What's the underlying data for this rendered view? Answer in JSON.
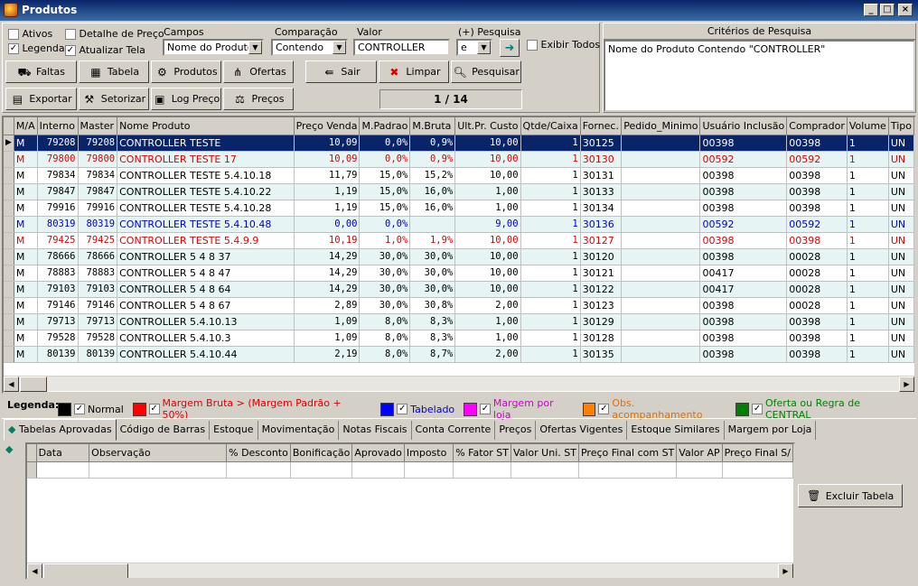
{
  "window": {
    "title": "Produtos",
    "min": "_",
    "max": "□",
    "close": "×"
  },
  "filters": {
    "ativos": "Ativos",
    "legenda": "Legenda",
    "detalhe_preco": "Detalhe de Preço",
    "atualizar_tela": "Atualizar Tela",
    "campos_label": "Campos",
    "campos_value": "Nome do Produto",
    "comparacao_label": "Comparação",
    "comparacao_value": "Contendo",
    "valor_label": "Valor",
    "valor_value": "CONTROLLER",
    "pesquisa_label": "(+) Pesquisa",
    "pesquisa_value": "e",
    "exibir_todos": "Exibir Todos"
  },
  "toolbar": {
    "faltas": "Faltas",
    "tabela": "Tabela",
    "produtos": "Produtos",
    "ofertas": "Ofertas",
    "sair": "Sair",
    "limpar": "Limpar",
    "pesquisar": "Pesquisar",
    "exportar": "Exportar",
    "setorizar": "Setorizar",
    "log_preco": "Log Preço",
    "precos": "Preços",
    "pagination": "1 / 14"
  },
  "criteria": {
    "title": "Critérios de Pesquisa",
    "text": "Nome do Produto Contendo \"CONTROLLER\""
  },
  "grid": {
    "columns": [
      "M/A",
      "Interno",
      "Master",
      "Nome Produto",
      "Preço Venda",
      "M.Padrao",
      "M.Bruta",
      "Ult.Pr. Custo",
      "Qtde/Caixa",
      "Fornec.",
      "Pedido_Minimo",
      "Usuário Inclusão",
      "Comprador",
      "Volume",
      "Tipo"
    ],
    "rows": [
      {
        "ma": "M",
        "interno": "79208",
        "master": "79208",
        "nome": "CONTROLLER TESTE",
        "venda": "10,09",
        "padrao": "0,0%",
        "bruta": "0,9%",
        "custo": "10,00",
        "qtde": "1",
        "fornec": "30125",
        "pedido": "",
        "usuario": "00398",
        "comprador": "00398",
        "volume": "1",
        "tipo": "UN",
        "style": "sel"
      },
      {
        "ma": "M",
        "interno": "79800",
        "master": "79800",
        "nome": "CONTROLLER TESTE 17",
        "venda": "10,09",
        "padrao": "0,0%",
        "bruta": "0,9%",
        "custo": "10,00",
        "qtde": "1",
        "fornec": "30130",
        "pedido": "",
        "usuario": "00592",
        "comprador": "00592",
        "volume": "1",
        "tipo": "UN",
        "style": "red alt"
      },
      {
        "ma": "M",
        "interno": "79834",
        "master": "79834",
        "nome": "CONTROLLER TESTE 5.4.10.18",
        "venda": "11,79",
        "padrao": "15,0%",
        "bruta": "15,2%",
        "custo": "10,00",
        "qtde": "1",
        "fornec": "30131",
        "pedido": "",
        "usuario": "00398",
        "comprador": "00398",
        "volume": "1",
        "tipo": "UN",
        "style": ""
      },
      {
        "ma": "M",
        "interno": "79847",
        "master": "79847",
        "nome": "CONTROLLER TESTE 5.4.10.22",
        "venda": "1,19",
        "padrao": "15,0%",
        "bruta": "16,0%",
        "custo": "1,00",
        "qtde": "1",
        "fornec": "30133",
        "pedido": "",
        "usuario": "00398",
        "comprador": "00398",
        "volume": "1",
        "tipo": "UN",
        "style": "alt"
      },
      {
        "ma": "M",
        "interno": "79916",
        "master": "79916",
        "nome": "CONTROLLER TESTE 5.4.10.28",
        "venda": "1,19",
        "padrao": "15,0%",
        "bruta": "16,0%",
        "custo": "1,00",
        "qtde": "1",
        "fornec": "30134",
        "pedido": "",
        "usuario": "00398",
        "comprador": "00398",
        "volume": "1",
        "tipo": "UN",
        "style": ""
      },
      {
        "ma": "M",
        "interno": "80319",
        "master": "80319",
        "nome": "CONTROLLER TESTE 5.4.10.48",
        "venda": "0,00",
        "padrao": "0,0%",
        "bruta": "",
        "custo": "9,00",
        "qtde": "1",
        "fornec": "30136",
        "pedido": "",
        "usuario": "00592",
        "comprador": "00592",
        "volume": "1",
        "tipo": "UN",
        "style": "blue alt"
      },
      {
        "ma": "M",
        "interno": "79425",
        "master": "79425",
        "nome": "CONTROLLER TESTE 5.4.9.9",
        "venda": "10,19",
        "padrao": "1,0%",
        "bruta": "1,9%",
        "custo": "10,00",
        "qtde": "1",
        "fornec": "30127",
        "pedido": "",
        "usuario": "00398",
        "comprador": "00398",
        "volume": "1",
        "tipo": "UN",
        "style": "red"
      },
      {
        "ma": "M",
        "interno": "78666",
        "master": "78666",
        "nome": "CONTROLLER 5 4 8 37",
        "venda": "14,29",
        "padrao": "30,0%",
        "bruta": "30,0%",
        "custo": "10,00",
        "qtde": "1",
        "fornec": "30120",
        "pedido": "",
        "usuario": "00398",
        "comprador": "00028",
        "volume": "1",
        "tipo": "UN",
        "style": "alt"
      },
      {
        "ma": "M",
        "interno": "78883",
        "master": "78883",
        "nome": "CONTROLLER 5 4 8 47",
        "venda": "14,29",
        "padrao": "30,0%",
        "bruta": "30,0%",
        "custo": "10,00",
        "qtde": "1",
        "fornec": "30121",
        "pedido": "",
        "usuario": "00417",
        "comprador": "00028",
        "volume": "1",
        "tipo": "UN",
        "style": ""
      },
      {
        "ma": "M",
        "interno": "79103",
        "master": "79103",
        "nome": "CONTROLLER 5 4 8 64",
        "venda": "14,29",
        "padrao": "30,0%",
        "bruta": "30,0%",
        "custo": "10,00",
        "qtde": "1",
        "fornec": "30122",
        "pedido": "",
        "usuario": "00417",
        "comprador": "00028",
        "volume": "1",
        "tipo": "UN",
        "style": "alt"
      },
      {
        "ma": "M",
        "interno": "79146",
        "master": "79146",
        "nome": "CONTROLLER 5 4 8 67",
        "venda": "2,89",
        "padrao": "30,0%",
        "bruta": "30,8%",
        "custo": "2,00",
        "qtde": "1",
        "fornec": "30123",
        "pedido": "",
        "usuario": "00398",
        "comprador": "00028",
        "volume": "1",
        "tipo": "UN",
        "style": ""
      },
      {
        "ma": "M",
        "interno": "79713",
        "master": "79713",
        "nome": "CONTROLLER 5.4.10.13",
        "venda": "1,09",
        "padrao": "8,0%",
        "bruta": "8,3%",
        "custo": "1,00",
        "qtde": "1",
        "fornec": "30129",
        "pedido": "",
        "usuario": "00398",
        "comprador": "00398",
        "volume": "1",
        "tipo": "UN",
        "style": "alt"
      },
      {
        "ma": "M",
        "interno": "79528",
        "master": "79528",
        "nome": "CONTROLLER 5.4.10.3",
        "venda": "1,09",
        "padrao": "8,0%",
        "bruta": "8,3%",
        "custo": "1,00",
        "qtde": "1",
        "fornec": "30128",
        "pedido": "",
        "usuario": "00398",
        "comprador": "00398",
        "volume": "1",
        "tipo": "UN",
        "style": ""
      },
      {
        "ma": "M",
        "interno": "80139",
        "master": "80139",
        "nome": "CONTROLLER 5.4.10.44",
        "venda": "2,19",
        "padrao": "8,0%",
        "bruta": "8,7%",
        "custo": "2,00",
        "qtde": "1",
        "fornec": "30135",
        "pedido": "",
        "usuario": "00398",
        "comprador": "00398",
        "volume": "1",
        "tipo": "UN",
        "style": "alt"
      }
    ]
  },
  "legend": {
    "title": "Legenda:",
    "items": [
      {
        "label": "Normal",
        "color": "#000000",
        "text_color": "#000000"
      },
      {
        "label": "Margem Bruta > (Margem Padrão + 50%)",
        "color": "#ff0000",
        "text_color": "#e00000"
      },
      {
        "label": "Tabelado",
        "color": "#0000ff",
        "text_color": "#0000d0"
      },
      {
        "label": "Margem por loja",
        "color": "#ff00ff",
        "text_color": "#d000d0"
      },
      {
        "label": "Obs. acompanhamento",
        "color": "#ff8000",
        "text_color": "#e07000"
      },
      {
        "label": "Oferta ou Regra de CENTRAL",
        "color": "#008000",
        "text_color": "#008000"
      }
    ]
  },
  "tabs": [
    "Tabelas Aprovadas",
    "Código de Barras",
    "Estoque",
    "Movimentação",
    "Notas Fiscais",
    "Conta Corrente",
    "Preços",
    "Ofertas Vigentes",
    "Estoque Similares",
    "Margem por Loja"
  ],
  "subgrid": {
    "columns": [
      "Data",
      "Observação",
      "% Desconto",
      "Bonificação",
      "Aprovado",
      "Imposto",
      "% Fator ST",
      "Valor Uni. ST",
      "Preço Final com ST",
      "Valor AP",
      "Preço Final S/"
    ]
  },
  "excluir_tabela": "Excluir Tabela"
}
